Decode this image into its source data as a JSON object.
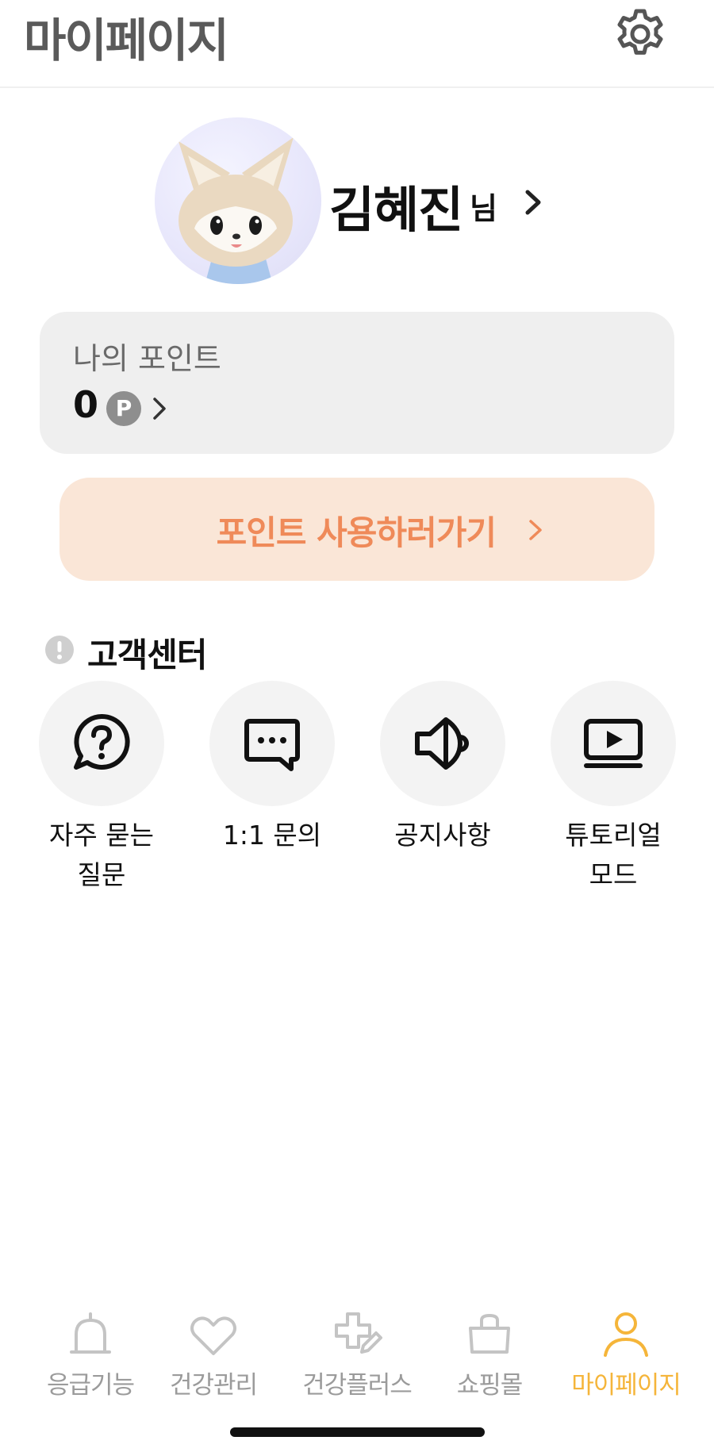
{
  "header": {
    "title": "마이페이지",
    "settings_icon": "gear-icon"
  },
  "profile": {
    "name": "김혜진",
    "suffix": "님",
    "avatar_icon": "fox-character-avatar"
  },
  "points": {
    "label": "나의 포인트",
    "value": "0",
    "badge": "P"
  },
  "use_points": {
    "label": "포인트 사용하러가기"
  },
  "support": {
    "title": "고객센터",
    "items": [
      {
        "label": "자주 묻는\n질문",
        "icon": "question-bubble-icon"
      },
      {
        "label": "1:1 문의",
        "icon": "chat-bubble-icon"
      },
      {
        "label": "공지사항",
        "icon": "megaphone-icon"
      },
      {
        "label": "튜토리얼\n모드",
        "icon": "video-play-icon"
      }
    ]
  },
  "tabbar": {
    "items": [
      {
        "label": "응급기능",
        "icon": "emergency-bell-icon"
      },
      {
        "label": "건강관리",
        "icon": "heart-icon"
      },
      {
        "label": "건강플러스",
        "icon": "plus-pencil-icon"
      },
      {
        "label": "쇼핑몰",
        "icon": "shopping-bag-icon"
      },
      {
        "label": "마이페이지",
        "icon": "person-icon"
      }
    ],
    "active": "마이페이지"
  },
  "colors": {
    "accent": "#f5b53a",
    "use_points_bg": "#fae6d7",
    "use_points_text": "#ef8a59",
    "card_bg": "#efefef"
  }
}
